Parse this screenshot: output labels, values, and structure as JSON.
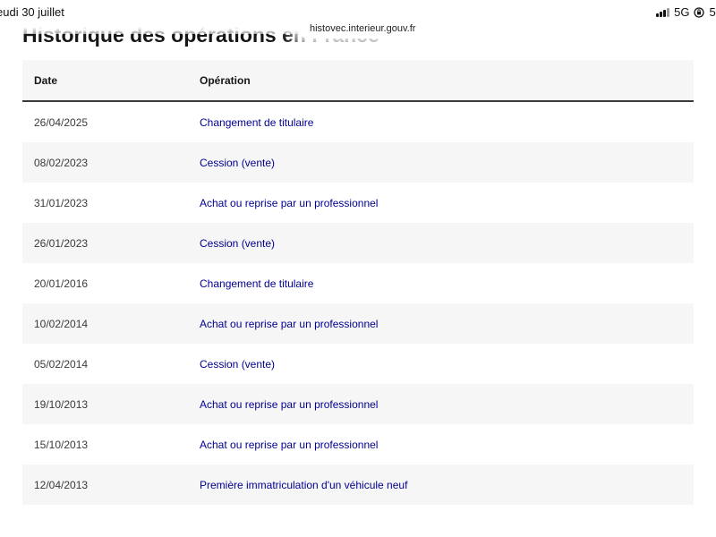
{
  "status_bar": {
    "time": "eudi 30 juillet",
    "network": "5G",
    "battery_partial": "5("
  },
  "browser": {
    "url": "histovec.interieur.gouv.fr"
  },
  "section": {
    "heading": "Historique des opérations en France"
  },
  "table": {
    "headers": {
      "date": "Date",
      "operation": "Opération"
    },
    "rows": [
      {
        "date": "26/04/2025",
        "operation": "Changement de titulaire"
      },
      {
        "date": "08/02/2023",
        "operation": "Cession (vente)"
      },
      {
        "date": "31/01/2023",
        "operation": "Achat ou reprise par un professionnel"
      },
      {
        "date": "26/01/2023",
        "operation": "Cession (vente)"
      },
      {
        "date": "20/01/2016",
        "operation": "Changement de titulaire"
      },
      {
        "date": "10/02/2014",
        "operation": "Achat ou reprise par un professionnel"
      },
      {
        "date": "05/02/2014",
        "operation": "Cession (vente)"
      },
      {
        "date": "19/10/2013",
        "operation": "Achat ou reprise par un professionnel"
      },
      {
        "date": "15/10/2013",
        "operation": "Achat ou reprise par un professionnel"
      },
      {
        "date": "12/04/2013",
        "operation": "Première immatriculation d'un véhicule neuf"
      }
    ]
  },
  "colors": {
    "link": "#000091",
    "stripe": "#f6f6f6",
    "header_border": "#3a3a3a"
  }
}
